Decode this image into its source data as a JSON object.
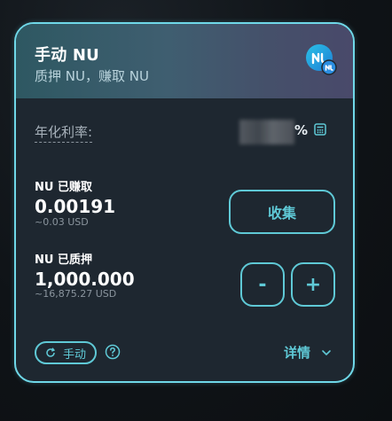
{
  "card": {
    "title": "手动 NU",
    "subtitle": "质押 NU，赚取 NU",
    "token_icon": "nu-token-icon",
    "accent_color": "#5fc9d6",
    "border_color": "#6fd8e8"
  },
  "apr": {
    "label": "年化利率:",
    "value_hidden": true,
    "percent_sign": "%",
    "calculator_icon": "calculator-icon"
  },
  "earned": {
    "label": "NU 已赚取",
    "amount": "0.00191",
    "usd": "~0.03 USD",
    "collect_label": "收集"
  },
  "staked": {
    "label": "NU 已质押",
    "amount": "1,000.000",
    "usd": "~16,875.27 USD",
    "minus_label": "-",
    "plus_label": "+"
  },
  "footer": {
    "manual_label": "手动",
    "refresh_icon": "refresh-icon",
    "help_icon": "question-circle-icon",
    "details_label": "详情",
    "chevron_icon": "chevron-down-icon"
  }
}
